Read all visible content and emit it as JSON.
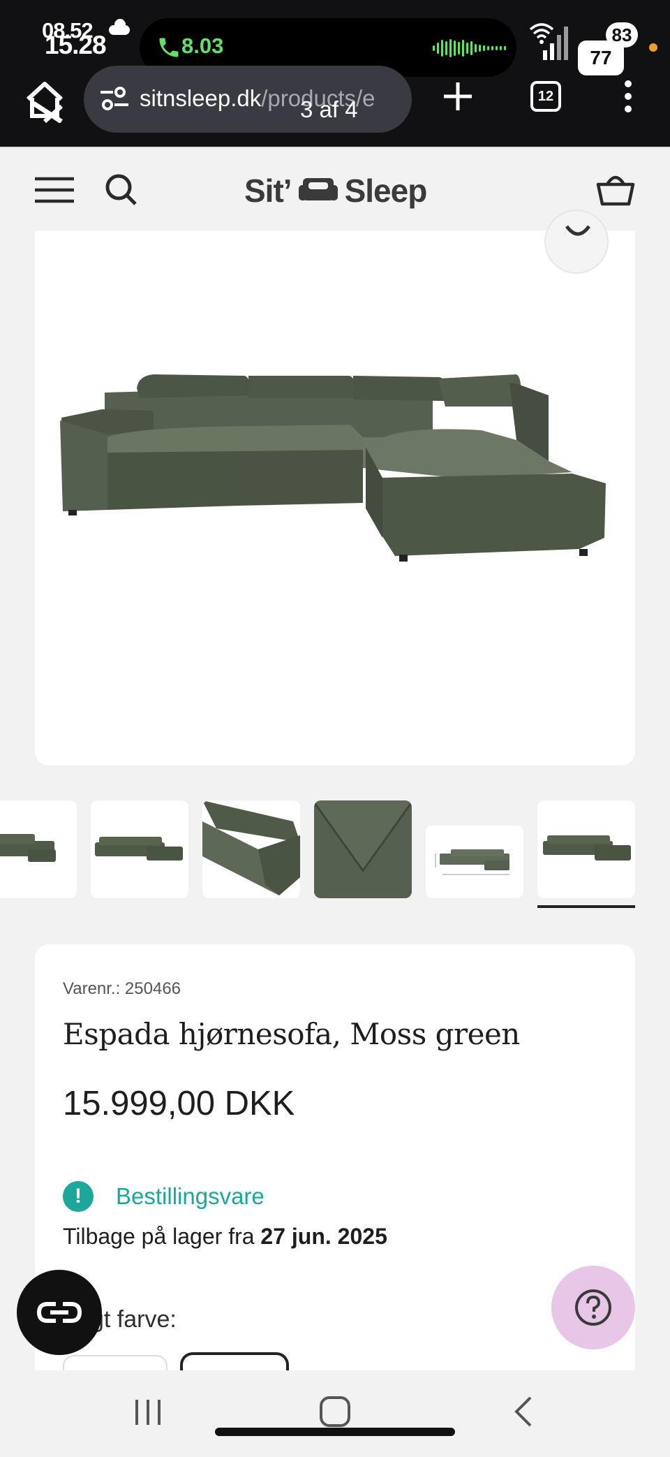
{
  "status_bar": {
    "time_overlay_1": "08.52",
    "time_overlay_2": "15.28",
    "call_duration": "8.03",
    "battery_top": "83",
    "battery_bottom": "77",
    "colors": {
      "call_green": "#62e06a",
      "notification_dot": "#f39b2c"
    }
  },
  "browser": {
    "url_domain": "sitnsleep.dk",
    "url_path": "/products/e",
    "page_counter": "3 af 4",
    "tab_count": "12"
  },
  "site": {
    "logo_left": "Sit’",
    "logo_right": "Sleep"
  },
  "product": {
    "sku": "Varenr.: 250466",
    "title": "Espada hjørnesofa, Moss green",
    "price": "15.999,00 DKK",
    "availability_label": "Bestillingsvare",
    "restock_prefix": "Tilbage på lager fra ",
    "restock_date": "27 jun. 2025",
    "color_label_partial": "gt farve:",
    "colors": {
      "accent_teal": "#1ba79a",
      "sofa_green": "#4f5a48"
    }
  },
  "gallery": {
    "selected_thumbnail": 6,
    "thumbnails": [
      "sofa-front-left-cropped",
      "sofa-front-view",
      "sofa-close-up-corner",
      "fabric-swatch-moss-green",
      "sofa-dimension-drawing",
      "sofa-front-view-selected"
    ]
  },
  "icons": [
    "home-off-icon",
    "site-settings-icon",
    "new-tab-plus-icon",
    "tabs-count-icon",
    "more-options-icon",
    "menu-hamburger-icon",
    "search-icon",
    "basket-icon",
    "zoom-icon",
    "reader-mode-icon",
    "help-question-icon",
    "recents-nav-icon",
    "home-nav-icon",
    "back-nav-icon"
  ]
}
